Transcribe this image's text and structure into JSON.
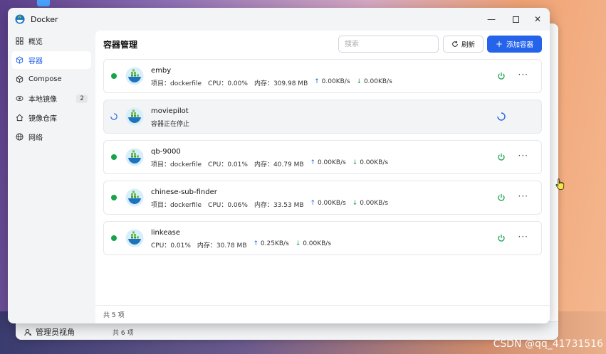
{
  "window": {
    "title": "Docker"
  },
  "sidebar": {
    "items": [
      {
        "label": "概览",
        "icon": "dashboard-icon"
      },
      {
        "label": "容器",
        "icon": "container-icon",
        "active": true
      },
      {
        "label": "Compose",
        "icon": "compose-icon"
      },
      {
        "label": "本地镜像",
        "icon": "image-icon",
        "badge": "2"
      },
      {
        "label": "镜像仓库",
        "icon": "registry-icon"
      },
      {
        "label": "网络",
        "icon": "network-icon"
      }
    ]
  },
  "header": {
    "title": "容器管理",
    "search_placeholder": "搜索",
    "refresh_label": "刷新",
    "add_label": "添加容器"
  },
  "containers": [
    {
      "name": "emby",
      "status": "running",
      "project_label": "项目：",
      "project": "dockerfile",
      "cpu_label": "CPU：",
      "cpu": "0.00%",
      "mem_label": "内存：",
      "mem": "309.98 MB",
      "up": "0.00KB/s",
      "down": "0.00KB/s"
    },
    {
      "name": "moviepilot",
      "status": "stopping",
      "status_text": "容器正在停止"
    },
    {
      "name": "qb-9000",
      "status": "running",
      "project_label": "项目：",
      "project": "dockerfile",
      "cpu_label": "CPU：",
      "cpu": "0.01%",
      "mem_label": "内存：",
      "mem": "40.79 MB",
      "up": "0.00KB/s",
      "down": "0.00KB/s"
    },
    {
      "name": "chinese-sub-finder",
      "status": "running",
      "project_label": "项目：",
      "project": "dockerfile",
      "cpu_label": "CPU：",
      "cpu": "0.06%",
      "mem_label": "内存：",
      "mem": "33.53 MB",
      "up": "0.00KB/s",
      "down": "0.00KB/s"
    },
    {
      "name": "linkease",
      "status": "running",
      "cpu_label": "CPU：",
      "cpu": "0.01%",
      "mem_label": "内存：",
      "mem": "30.78 MB",
      "up": "0.25KB/s",
      "down": "0.00KB/s"
    }
  ],
  "footer": {
    "count": "共 5 项"
  },
  "behind_window": {
    "user": "管理员视角",
    "count": "共 6 项"
  },
  "watermark": "CSDN @qq_41731516",
  "colors": {
    "accent": "#2563eb",
    "running": "#16a34a"
  }
}
